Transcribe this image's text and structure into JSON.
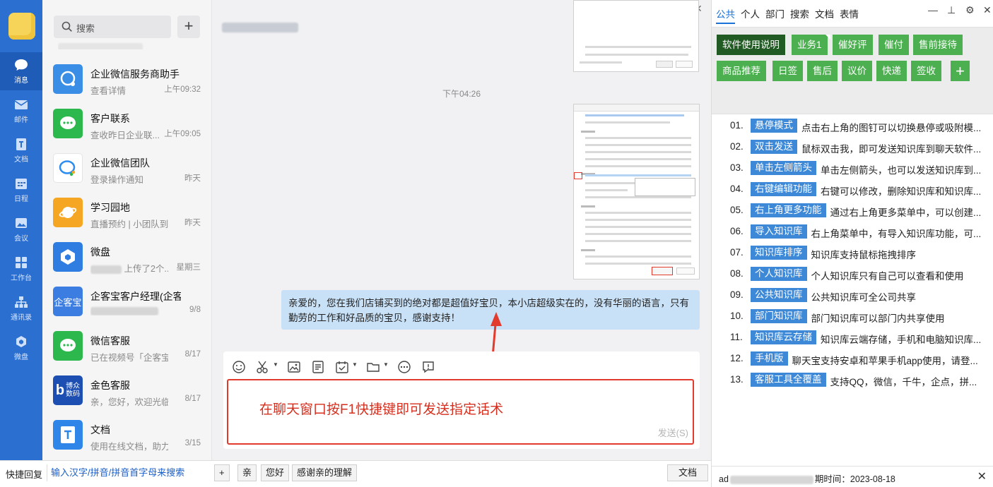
{
  "rail": {
    "items": [
      {
        "label": "消息",
        "icon": "chat-bubble-icon"
      },
      {
        "label": "邮件",
        "icon": "mail-icon"
      },
      {
        "label": "文档",
        "icon": "document-icon"
      },
      {
        "label": "日程",
        "icon": "calendar-icon"
      },
      {
        "label": "会议",
        "icon": "meeting-icon"
      },
      {
        "label": "工作台",
        "icon": "apps-grid-icon"
      },
      {
        "label": "通讯录",
        "icon": "org-chart-icon"
      },
      {
        "label": "微盘",
        "icon": "cloud-drive-icon"
      }
    ]
  },
  "conv_list": {
    "search_placeholder": "搜索",
    "items": [
      {
        "name": "企业微信服务商助手",
        "preview": "查看详情",
        "time": "上午09:32",
        "color": "#3a8ee6"
      },
      {
        "name": "客户联系",
        "preview": "查收昨日企业联...",
        "time": "上午09:05",
        "color": "#2db84d"
      },
      {
        "name": "企业微信团队",
        "preview": "登录操作通知",
        "time": "昨天",
        "color": "#ffffff"
      },
      {
        "name": "学习园地",
        "preview": "直播预约 | 小团队到...",
        "time": "昨天",
        "color": "#f5a623"
      },
      {
        "name": "微盘",
        "preview": "上传了2个...",
        "time": "星期三",
        "color": "#2f7de1"
      },
      {
        "name": "企客宝客户经理(企客...",
        "preview": "",
        "time": "9/8",
        "color": "#3b7de0",
        "avatar_text": "企客宝"
      },
      {
        "name": "微信客服",
        "preview": "已在视频号「企客宝...",
        "time": "8/17",
        "color": "#2db84d"
      },
      {
        "name": "金色客服",
        "preview": "亲，您好，欢迎光临...",
        "time": "8/17",
        "color": "#1d4fb3",
        "avatar_text": "b 博众\n数码"
      },
      {
        "name": "文档",
        "preview": "使用在线文档，助力...",
        "time": "3/15",
        "color": "#2f86e8"
      }
    ]
  },
  "chat": {
    "time": "下午04:26",
    "message": "亲爱的，您在我们店铺买到的绝对都是超值好宝贝，本小店超级实在的，没有华丽的语言，只有勤劳的工作和好品质的宝贝，感谢支持！",
    "input_hint": "在聊天窗口按F1快捷键即可发送指定话术",
    "send_label": "发送(S)"
  },
  "panel": {
    "tabs": [
      "公共",
      "个人",
      "部门",
      "搜索",
      "文档",
      "表情"
    ],
    "categories": [
      "软件使用说明",
      "业务1",
      "催好评",
      "催付",
      "售前接待",
      "商品推荐",
      "日签",
      "售后",
      "议价",
      "快递",
      "签收",
      "+"
    ],
    "kb_items": [
      {
        "num": "01.",
        "tag": "悬停模式",
        "text": "点击右上角的图钉可以切换悬停或吸附模..."
      },
      {
        "num": "02.",
        "tag": "双击发送",
        "text": "鼠标双击我，即可发送知识库到聊天软件..."
      },
      {
        "num": "03.",
        "tag": "单击左侧箭头",
        "text": "单击左侧箭头，也可以发送知识库到..."
      },
      {
        "num": "04.",
        "tag": "右键编辑功能",
        "text": "右键可以修改，删除知识库和知识库..."
      },
      {
        "num": "05.",
        "tag": "右上角更多功能",
        "text": "通过右上角更多菜单中，可以创建..."
      },
      {
        "num": "06.",
        "tag": "导入知识库",
        "text": "右上角菜单中，有导入知识库功能，可..."
      },
      {
        "num": "07.",
        "tag": "知识库排序",
        "text": "知识库支持鼠标拖拽排序"
      },
      {
        "num": "08.",
        "tag": "个人知识库",
        "text": "个人知识库只有自己可以查看和使用"
      },
      {
        "num": "09.",
        "tag": "公共知识库",
        "text": "公共知识库可全公司共享"
      },
      {
        "num": "10.",
        "tag": "部门知识库",
        "text": "部门知识库可以部门内共享使用"
      },
      {
        "num": "11.",
        "tag": "知识库云存储",
        "text": "知识库云端存储，手机和电脑知识库..."
      },
      {
        "num": "12.",
        "tag": "手机版",
        "text": "聊天宝支持安卓和苹果手机app使用，请登..."
      },
      {
        "num": "13.",
        "tag": "客服工具全覆盖",
        "text": "支持QQ，微信，千牛，企点，拼..."
      }
    ],
    "footer_prefix": "ad",
    "footer_text": "期时间：2023-08-18"
  },
  "quickbar": {
    "quick_reply": "快捷回复",
    "search_hint": "输入汉字/拼音/拼音首字母来搜索",
    "phrases": [
      "亲",
      "您好",
      "感谢亲的理解"
    ],
    "doc_label": "文档"
  },
  "colors": {
    "rail": "#2b6fd0",
    "category_green": "#4caf50",
    "category_selected": "#215a23",
    "kb_tag_blue": "#3d89d8",
    "bubble": "#c9e1f7",
    "annotation_red": "#e23a2c"
  }
}
